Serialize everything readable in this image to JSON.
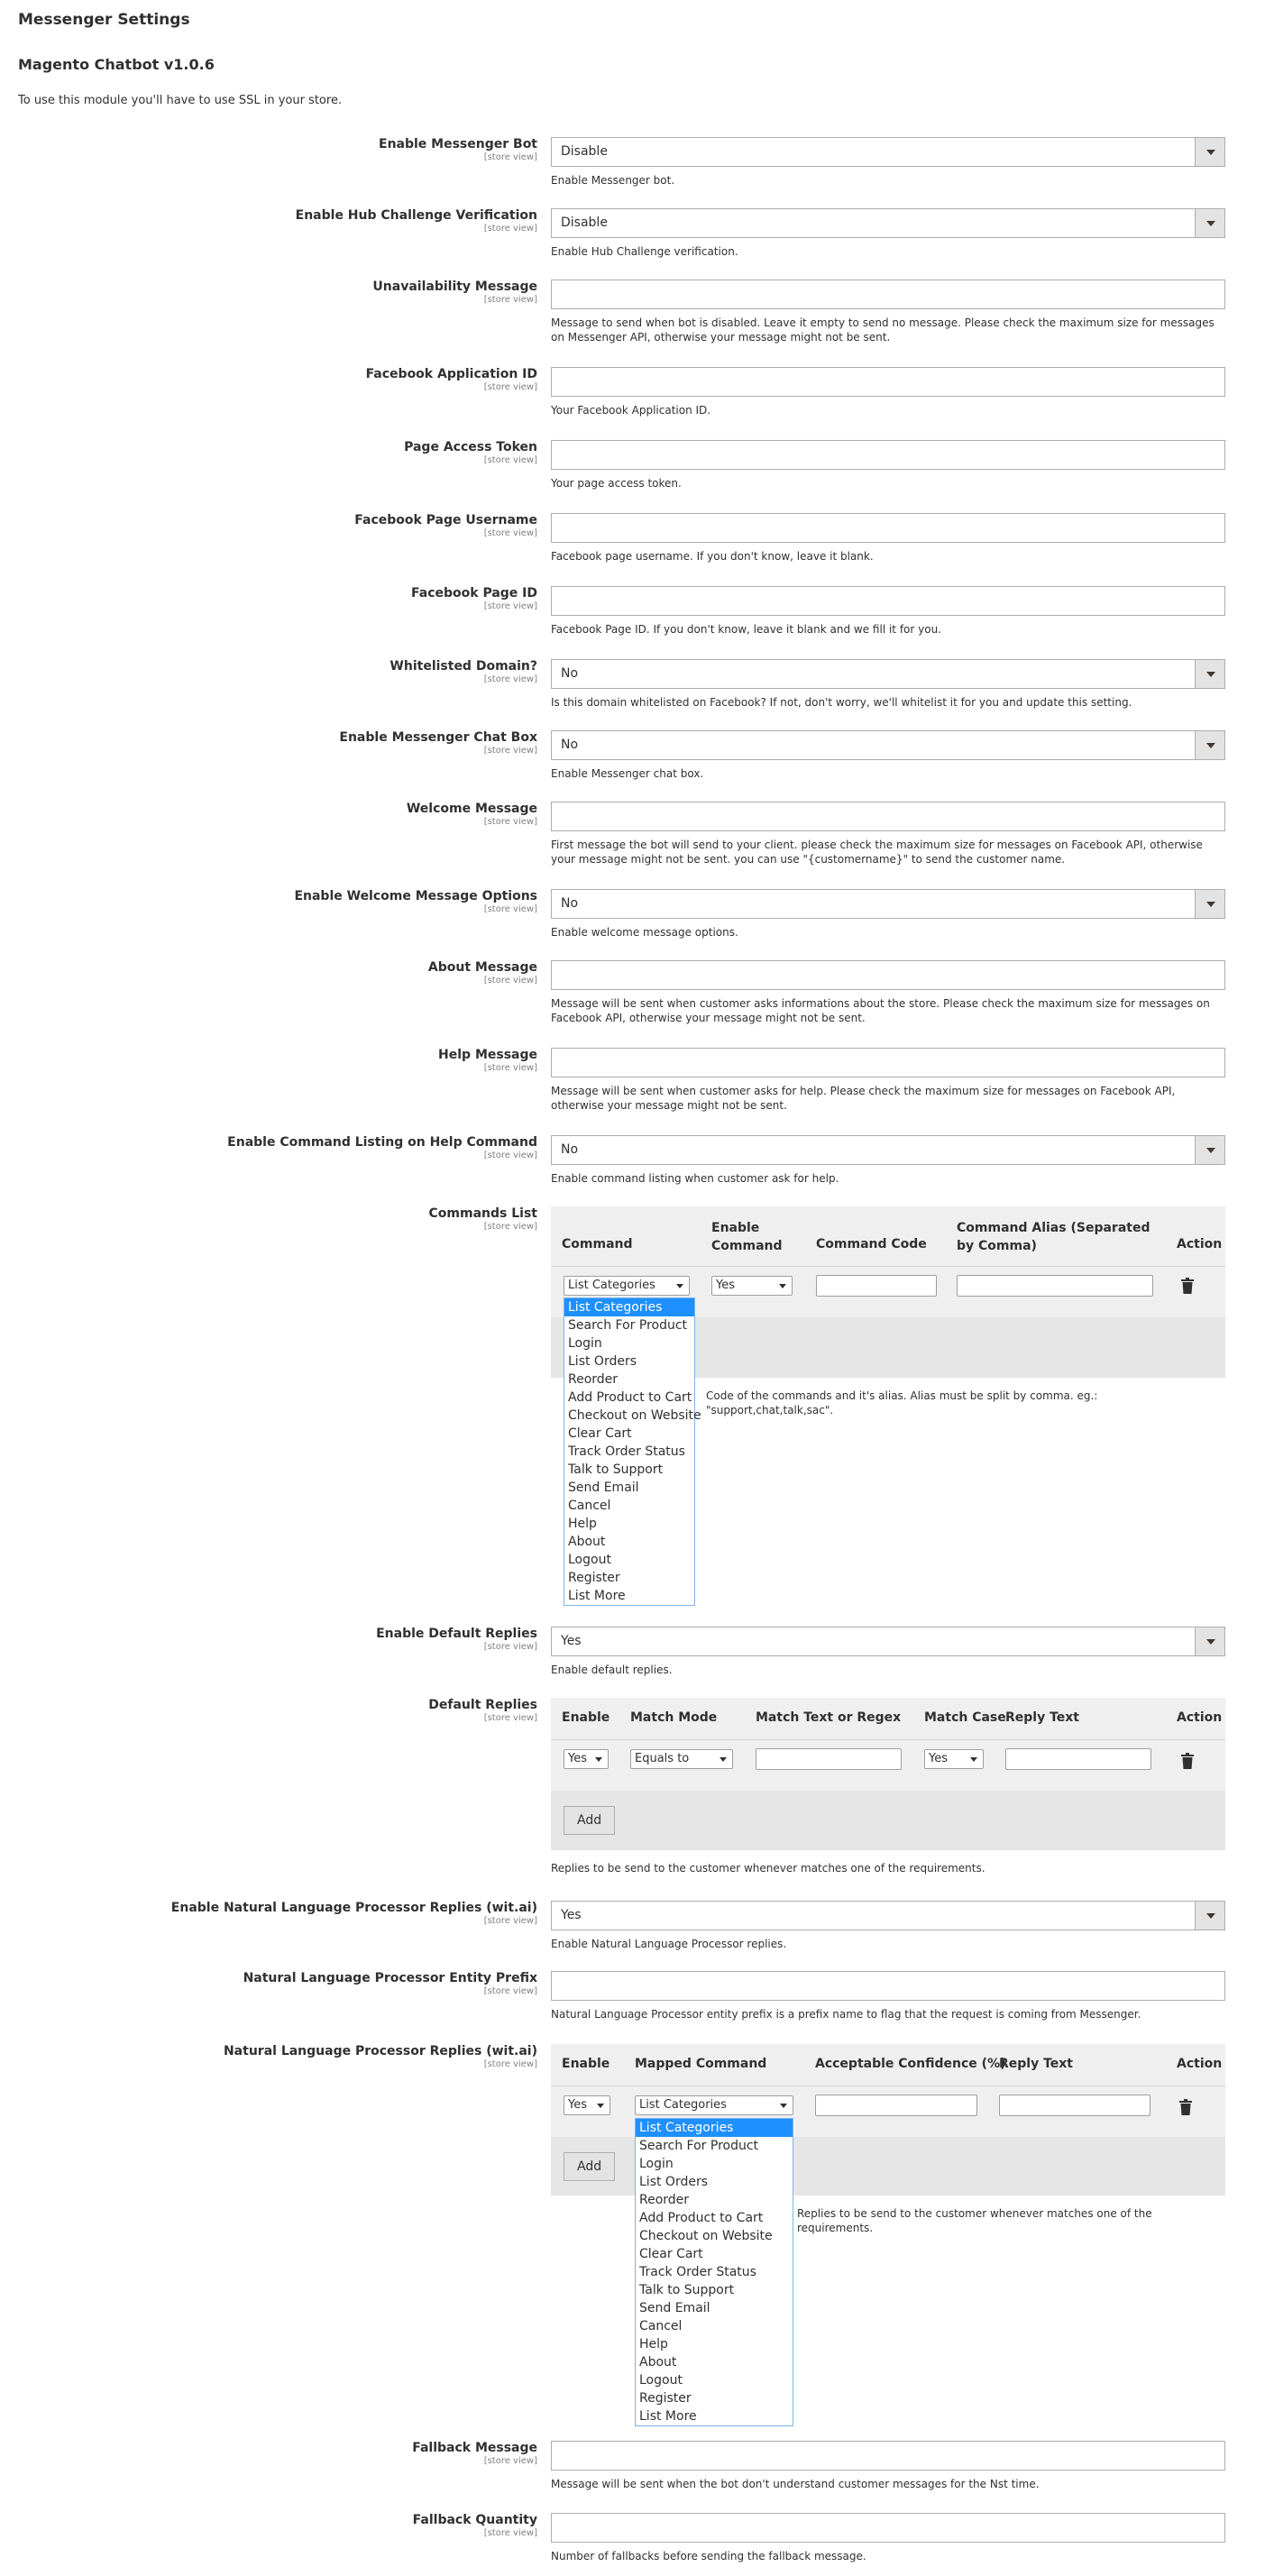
{
  "page": {
    "title": "Messenger Settings",
    "module_title": "Magento Chatbot v1.0.6",
    "ssl_note": "To use this module you'll have to use SSL in your store.",
    "scope_label": "[store view]"
  },
  "fields": {
    "enable_bot": {
      "label": "Enable Messenger Bot",
      "value": "Disable",
      "note": "Enable Messenger bot."
    },
    "enable_hub": {
      "label": "Enable Hub Challenge Verification",
      "value": "Disable",
      "note": "Enable Hub Challenge verification."
    },
    "unavailability": {
      "label": "Unavailability Message",
      "value": "",
      "note": "Message to send when bot is disabled. Leave it empty to send no message. Please check the maximum size for messages on Messenger API, otherwise your message might not be sent."
    },
    "fb_app_id": {
      "label": "Facebook Application ID",
      "value": "",
      "note": "Your Facebook Application ID."
    },
    "page_token": {
      "label": "Page Access Token",
      "value": "",
      "note": "Your page access token."
    },
    "fb_page_username": {
      "label": "Facebook Page Username",
      "value": "",
      "note": "Facebook page username. If you don't know, leave it blank."
    },
    "fb_page_id": {
      "label": "Facebook Page ID",
      "value": "",
      "note": "Facebook Page ID. If you don't know, leave it blank and we fill it for you."
    },
    "whitelisted": {
      "label": "Whitelisted Domain?",
      "value": "No",
      "note": "Is this domain whitelisted on Facebook? If not, don't worry, we'll whitelist it for you and update this setting."
    },
    "chat_box": {
      "label": "Enable Messenger Chat Box",
      "value": "No",
      "note": "Enable Messenger chat box."
    },
    "welcome": {
      "label": "Welcome Message",
      "value": "",
      "note": "First message the bot will send to your client. please check the maximum size for messages on Facebook API, otherwise your message might not be sent. you can use \"{customername}\" to send the customer name."
    },
    "welcome_options": {
      "label": "Enable Welcome Message Options",
      "value": "No",
      "note": "Enable welcome message options."
    },
    "about": {
      "label": "About Message",
      "value": "",
      "note": "Message will be sent when customer asks informations about the store. Please check the maximum size for messages on Facebook API, otherwise your message might not be sent."
    },
    "help": {
      "label": "Help Message",
      "value": "",
      "note": "Message will be sent when customer asks for help. Please check the maximum size for messages on Facebook API, otherwise your message might not be sent."
    },
    "cmd_listing": {
      "label": "Enable Command Listing on Help Command",
      "value": "No",
      "note": "Enable command listing when customer ask for help."
    },
    "commands_list": {
      "label": "Commands List",
      "headers": {
        "command": "Command",
        "enable": "Enable Command",
        "code": "Command Code",
        "alias": "Command Alias (Separated by Comma)",
        "action": "Action"
      },
      "row": {
        "command": "List Categories",
        "enable": "Yes"
      },
      "note": "Code of the commands and it's alias. Alias must be split by comma. eg.: \"support,chat,talk,sac\"."
    },
    "default_replies_enable": {
      "label": "Enable Default Replies",
      "value": "Yes",
      "note": "Enable default replies."
    },
    "default_replies": {
      "label": "Default Replies",
      "headers": {
        "enable": "Enable",
        "mode": "Match Mode",
        "text": "Match Text or Regex",
        "case": "Match Case",
        "reply": "Reply Text",
        "action": "Action"
      },
      "row": {
        "enable": "Yes",
        "mode": "Equals to",
        "case": "Yes"
      },
      "add": "Add",
      "note": "Replies to be send to the customer whenever matches one of the requirements."
    },
    "nlp_enable": {
      "label": "Enable Natural Language Processor Replies (wit.ai)",
      "value": "Yes",
      "note": "Enable Natural Language Processor replies."
    },
    "nlp_prefix": {
      "label": "Natural Language Processor Entity Prefix",
      "value": "",
      "note": "Natural Language Processor entity prefix is a prefix name to flag that the request is coming from Messenger."
    },
    "nlp_replies": {
      "label": "Natural Language Processor Replies (wit.ai)",
      "headers": {
        "enable": "Enable",
        "mapped": "Mapped Command",
        "confidence": "Acceptable Confidence (%)",
        "reply": "Reply Text",
        "action": "Action"
      },
      "row": {
        "enable": "Yes",
        "mapped": "List Categories"
      },
      "add": "Add",
      "note": "Replies to be send to the customer whenever matches one of the requirements."
    },
    "fallback_msg": {
      "label": "Fallback Message",
      "value": "",
      "note": "Message will be sent when the bot don't understand customer messages for the Nst time."
    },
    "fallback_qty": {
      "label": "Fallback Quantity",
      "value": "",
      "note": "Number of fallbacks before sending the fallback message."
    }
  },
  "command_options": [
    "List Categories",
    "Search For Product",
    "Login",
    "List Orders",
    "Reorder",
    "Add Product to Cart",
    "Checkout on Website",
    "Clear Cart",
    "Track Order Status",
    "Talk to Support",
    "Send Email",
    "Cancel",
    "Help",
    "About",
    "Logout",
    "Register",
    "List More"
  ],
  "colors": {
    "highlight": "#1e90ff",
    "grid_bg": "#efefef",
    "border": "#adadad"
  }
}
